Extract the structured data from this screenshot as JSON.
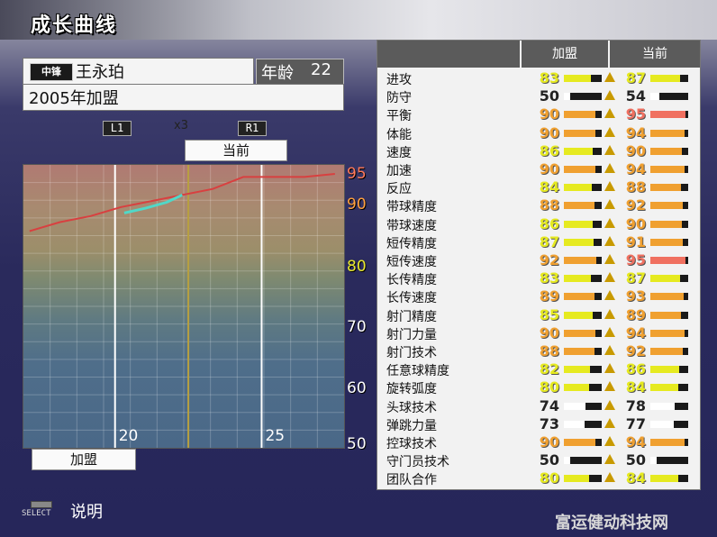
{
  "title": "成长曲线",
  "player": {
    "position": "中锋",
    "name": "王永珀",
    "age_label": "年龄",
    "age": "22",
    "joined": "2005年加盟"
  },
  "controls": {
    "l1": "L1",
    "r1": "R1",
    "zoom": "x3"
  },
  "chart_labels": {
    "current": "当前",
    "joined": "加盟"
  },
  "chart_data": {
    "type": "line",
    "x_ticks": [
      "20",
      "25"
    ],
    "y_ticks": [
      "95",
      "90",
      "80",
      "70",
      "60",
      "50"
    ],
    "y_tick_colors": [
      "#ff7a5a",
      "#ffa040",
      "#e8e830",
      "#ffffff",
      "#ffffff",
      "#ffffff"
    ],
    "series": [
      {
        "x": [
          17.5,
          18.5,
          19.5,
          20.5,
          21.5,
          22.5,
          23.5,
          24.5,
          25.5,
          26.5,
          27.5
        ],
        "y": [
          86,
          87.5,
          88.5,
          90,
          91,
          92,
          93,
          95,
          95,
          95,
          95.5
        ],
        "color": "#d84040"
      },
      {
        "x": [
          20.6,
          21.3,
          22.0,
          22.5
        ],
        "y": [
          89,
          89.8,
          90.8,
          92
        ],
        "color": "#50d8c8"
      }
    ],
    "ylim": [
      50,
      97
    ],
    "xlim": [
      17.3,
      27.8
    ]
  },
  "table": {
    "headers": {
      "joined": "加盟",
      "current": "当前"
    },
    "rows": [
      {
        "attr": "进攻",
        "joined": "83",
        "current": "87"
      },
      {
        "attr": "防守",
        "joined": "50",
        "current": "54"
      },
      {
        "attr": "平衡",
        "joined": "90",
        "current": "95"
      },
      {
        "attr": "体能",
        "joined": "90",
        "current": "94"
      },
      {
        "attr": "速度",
        "joined": "86",
        "current": "90"
      },
      {
        "attr": "加速",
        "joined": "90",
        "current": "94"
      },
      {
        "attr": "反应",
        "joined": "84",
        "current": "88"
      },
      {
        "attr": "带球精度",
        "joined": "88",
        "current": "92"
      },
      {
        "attr": "带球速度",
        "joined": "86",
        "current": "90"
      },
      {
        "attr": "短传精度",
        "joined": "87",
        "current": "91"
      },
      {
        "attr": "短传速度",
        "joined": "92",
        "current": "95"
      },
      {
        "attr": "长传精度",
        "joined": "83",
        "current": "87"
      },
      {
        "attr": "长传速度",
        "joined": "89",
        "current": "93"
      },
      {
        "attr": "射门精度",
        "joined": "85",
        "current": "89"
      },
      {
        "attr": "射门力量",
        "joined": "90",
        "current": "94"
      },
      {
        "attr": "射门技术",
        "joined": "88",
        "current": "92"
      },
      {
        "attr": "任意球精度",
        "joined": "82",
        "current": "86"
      },
      {
        "attr": "旋转弧度",
        "joined": "80",
        "current": "84"
      },
      {
        "attr": "头球技术",
        "joined": "74",
        "current": "78"
      },
      {
        "attr": "弹跳力量",
        "joined": "73",
        "current": "77"
      },
      {
        "attr": "控球技术",
        "joined": "90",
        "current": "94"
      },
      {
        "attr": "守门员技术",
        "joined": "50",
        "current": "50"
      },
      {
        "attr": "团队合作",
        "joined": "80",
        "current": "84"
      }
    ]
  },
  "footer": {
    "select": "SELECT",
    "help": "说明"
  },
  "watermark": "富运健动科技网"
}
